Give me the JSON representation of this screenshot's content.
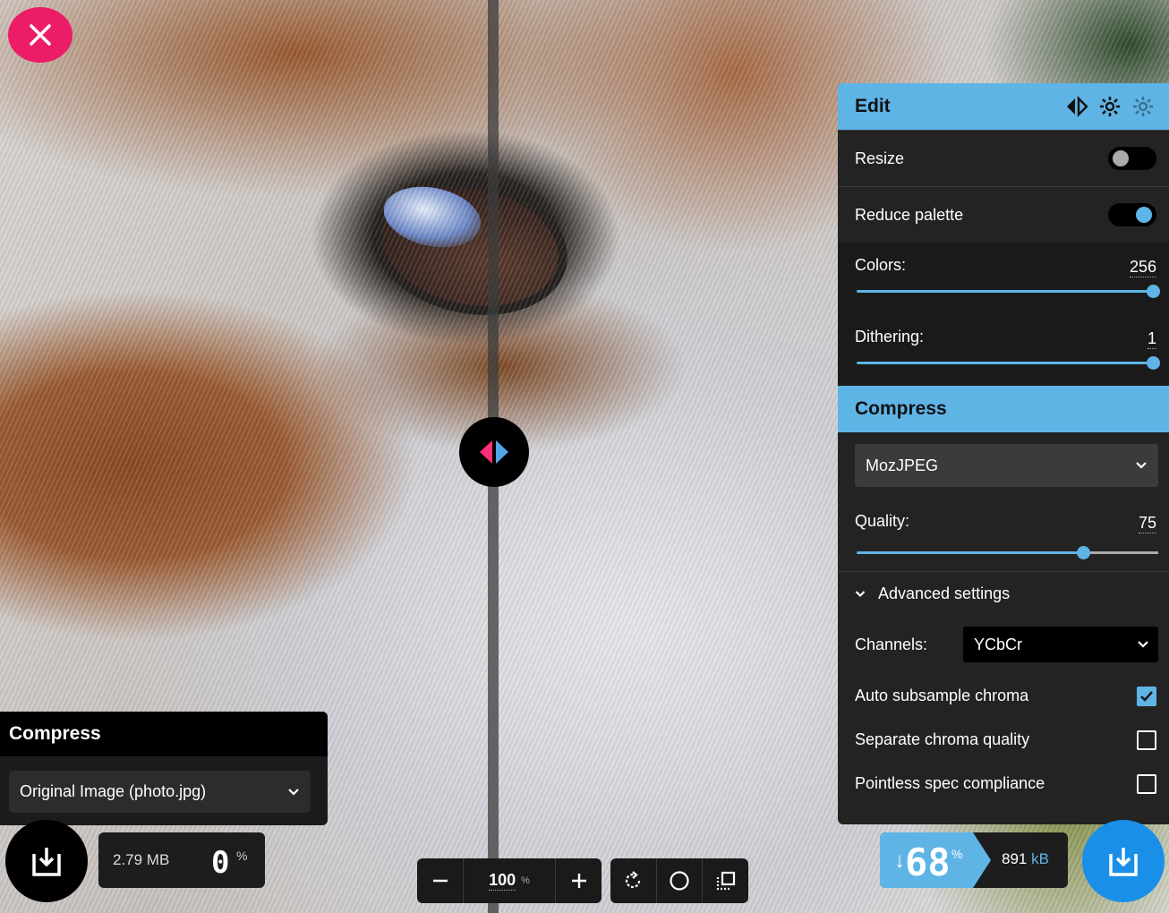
{
  "left_panel": {
    "title": "Compress",
    "source_select": "Original Image (photo.jpg)"
  },
  "left_stats": {
    "size": "2.79 MB",
    "percent": "0",
    "percent_sign": "%"
  },
  "zoom": {
    "value": "100",
    "unit": "%"
  },
  "edit_panel": {
    "title": "Edit",
    "resize_label": "Resize",
    "resize_on": false,
    "reduce_palette_label": "Reduce palette",
    "reduce_palette_on": true,
    "colors_label": "Colors:",
    "colors_value": "256",
    "colors_fraction": 1.0,
    "dithering_label": "Dithering:",
    "dithering_value": "1",
    "dithering_fraction": 1.0
  },
  "compress_panel": {
    "title": "Compress",
    "codec": "MozJPEG",
    "quality_label": "Quality:",
    "quality_value": "75",
    "quality_fraction": 0.75,
    "advanced_label": "Advanced settings",
    "channels_label": "Channels:",
    "channels_value": "YCbCr",
    "options": [
      {
        "label": "Auto subsample chroma",
        "checked": true
      },
      {
        "label": "Separate chroma quality",
        "checked": false
      },
      {
        "label": "Pointless spec compliance",
        "checked": false
      }
    ]
  },
  "right_stats": {
    "arrow": "↓",
    "percent": "68",
    "percent_sign": "%",
    "size": "891",
    "unit": "kB"
  },
  "colors": {
    "accent": "#5fb4e6",
    "close": "#ec1d66",
    "download": "#1a8fe8"
  },
  "icons": {
    "close": "close-icon",
    "download": "download-icon",
    "rotate": "rotate-icon",
    "background": "circle-icon",
    "crop": "crop-icon",
    "swap": "swap-sides-icon",
    "settings": "gear-icon"
  }
}
